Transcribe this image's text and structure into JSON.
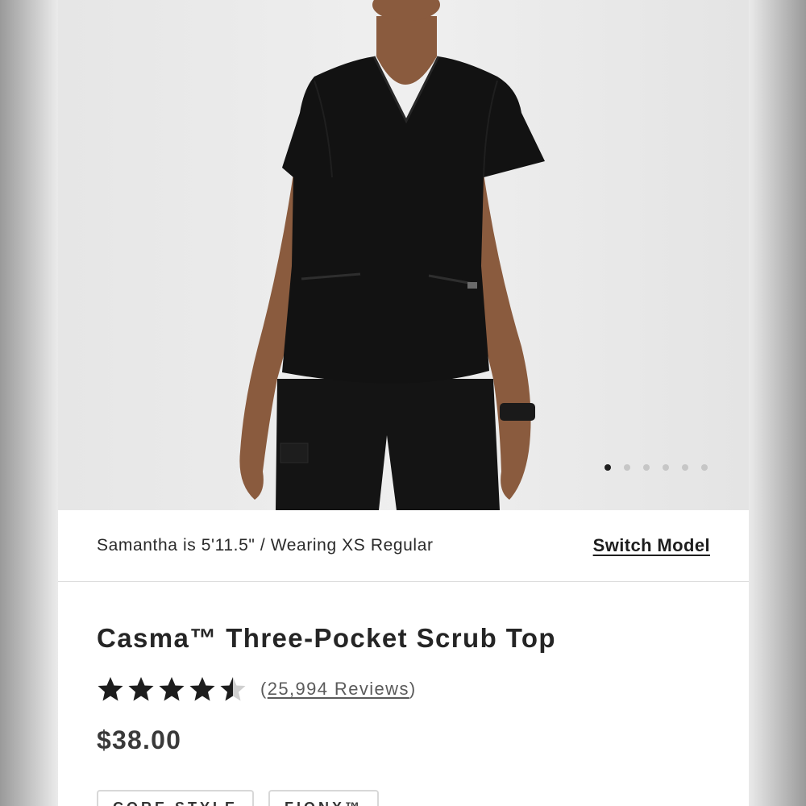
{
  "gallery": {
    "image_alt": "Model wearing black three-pocket scrub top and black scrub pants",
    "dots_count": 6,
    "active_dot": 0
  },
  "model_info": {
    "text": "Samantha is 5'11.5\" / Wearing XS Regular",
    "switch_label": "Switch Model"
  },
  "product": {
    "title": "Casma™ Three-Pocket Scrub Top",
    "rating": 4.5,
    "rating_max": 5,
    "reviews_open": "(",
    "reviews_label": "25,994 Reviews",
    "reviews_close": ")",
    "price": "$38.00",
    "tags": [
      "CORE STYLE",
      "FIONX™"
    ]
  },
  "colors": {
    "star": "#1d1d1d",
    "star_empty": "#cfcfcf",
    "garment": "#121212",
    "skin": "#8a5b3e"
  }
}
